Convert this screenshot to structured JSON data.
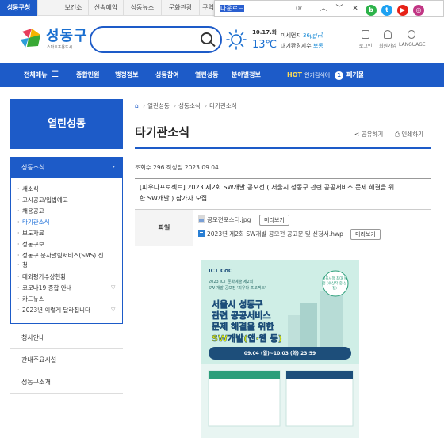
{
  "topbar": {
    "tabs": [
      "성동구청",
      "보건소",
      "신속예약",
      "성동뉴스",
      "문화관광",
      "구억"
    ],
    "find": {
      "query": "다운로드",
      "count": "0/1"
    }
  },
  "header": {
    "logo_text": "성동구",
    "logo_sub": "스마트포용도시",
    "date": "10.17.화",
    "temp": "13℃",
    "air1_label": "미세먼지",
    "air1_value": "36㎍/㎥",
    "air2_label": "대기환경지수",
    "air2_value": "보통",
    "utils": [
      "로그인",
      "회원가입",
      "LANGUAGE"
    ]
  },
  "nav": {
    "all_menu": "전체메뉴",
    "items": [
      "종합민원",
      "행정정보",
      "성동참여",
      "열린성동",
      "분야별정보"
    ],
    "hot_label": "HOT",
    "hot_text": "인기검색어",
    "hot_rank": "1",
    "hot_keyword": "폐기물"
  },
  "sidebar": {
    "title": "열린성동",
    "section": "성동소식",
    "items": [
      "새소식",
      "고시공고/입법예고",
      "채용공고",
      "타기관소식",
      "보도자료",
      "성동구보",
      "성동구 문자알림서비스(SMS) 신",
      "청",
      "대외평가수상현황",
      "코로나19 종합 안내",
      "카드뉴스",
      "2023년 이렇게 달라집니다"
    ],
    "menus": [
      "청사안내",
      "관내주요시설",
      "성동구소개"
    ]
  },
  "main": {
    "breadcrumb": [
      "열린성동",
      "성동소식",
      "타기관소식"
    ],
    "title": "타기관소식",
    "share": "공유하기",
    "print": "인쇄하기",
    "meta": "조회수 296 작성일 2023.09.04",
    "post_title_1": "[피우다프로젝트] 2023 제2회 SW개발 공모전 ( 서울시 성동구 관련 공공서비스 문제 해결을 위",
    "post_title_2": "한 SW개발 ) 참가자 모집",
    "file_label": "파일",
    "files": [
      {
        "name": "공모전포스터.jpg",
        "button": "미리보기"
      },
      {
        "name": "2023년 제2회 SW개발 공모전 공고문 및 신청서.hwp",
        "button": "미리보기"
      }
    ]
  },
  "poster": {
    "brand": "ICT CoC",
    "sub1": "2023 ICT 문화예술 제2회",
    "sub2": "SW 개발 공모전 '피우다 프로젝트'",
    "badge": "서울시청 최대 예정 (수상작 중 선정)",
    "head1": "서울시 성동구",
    "head2": "관련 공공서비스",
    "head3": "문제 해결을 위한",
    "head4": "SW개발(앱·웹 등)",
    "period": "09.04 (월)~10.03 (화) 23:59"
  },
  "colors": {
    "primary": "#1d5bc8",
    "link": "#1d6fd8",
    "poster_bg": "#cfeee6"
  }
}
